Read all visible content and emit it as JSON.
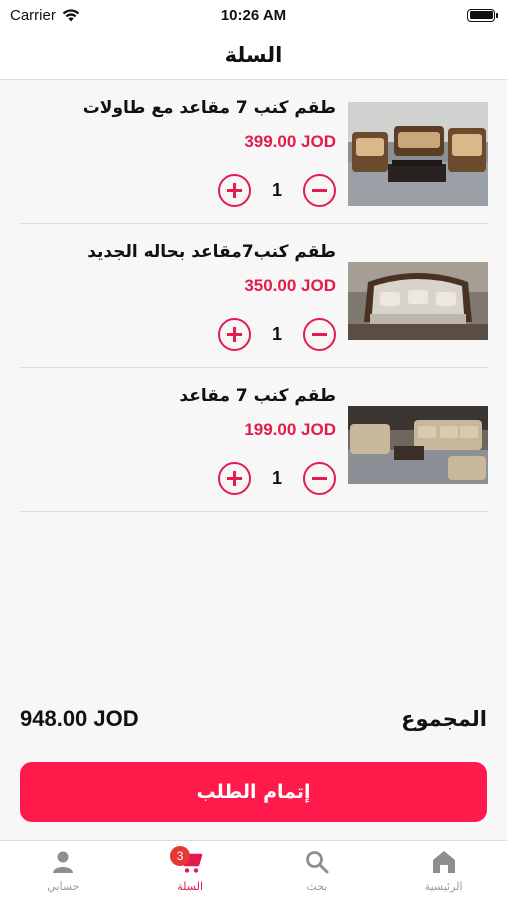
{
  "status_bar": {
    "carrier": "Carrier",
    "time": "10:26 AM"
  },
  "header": {
    "title": "السلة"
  },
  "cart": {
    "items": [
      {
        "name": "طقم كنب 7 مقاعد مع طاولات",
        "price": "399.00 JOD",
        "quantity": "1"
      },
      {
        "name": "طقم كنب7مقاعد بحاله الجديد",
        "price": "350.00 JOD",
        "quantity": "1"
      },
      {
        "name": "طقم كنب 7 مقاعد",
        "price": "199.00 JOD",
        "quantity": "1"
      }
    ]
  },
  "summary": {
    "total_label": "المجموع",
    "total_value": "948.00 JOD"
  },
  "checkout": {
    "label": "إتمام الطلب"
  },
  "tab_bar": {
    "tabs": [
      {
        "label": "حسابي",
        "icon": "person-icon"
      },
      {
        "label": "السلة",
        "icon": "cart-icon",
        "badge": "3"
      },
      {
        "label": "بحث",
        "icon": "search-icon"
      },
      {
        "label": "الرئيسية",
        "icon": "home-icon"
      }
    ],
    "active_tab": "السلة"
  },
  "colors": {
    "accent": "#e31d4b",
    "button": "#ff1a4b",
    "badge": "#e53935"
  }
}
